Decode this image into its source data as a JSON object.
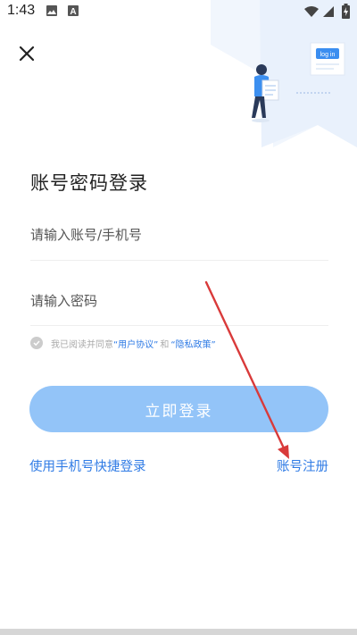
{
  "status_bar": {
    "time": "1:43",
    "icons": [
      "image-icon",
      "a-letter-icon",
      "wifi-icon",
      "signal-icon",
      "battery-charging-icon"
    ]
  },
  "illustration": {
    "note_label": "log in"
  },
  "title": "账号密码登录",
  "account_input": {
    "placeholder": "请输入账号/手机号",
    "value": ""
  },
  "password_input": {
    "placeholder": "请输入密码",
    "value": ""
  },
  "agreement": {
    "prefix": "我已阅读并同意",
    "user_agreement": "“用户协议”",
    "and": "和",
    "privacy_policy": "“隐私政策”",
    "checked": false
  },
  "login_button": "立即登录",
  "phone_login_link": "使用手机号快捷登录",
  "register_link": "账号注册",
  "colors": {
    "accent": "#2f7be5",
    "button": "#93c4f8",
    "annotation_arrow": "#d93a3a"
  }
}
